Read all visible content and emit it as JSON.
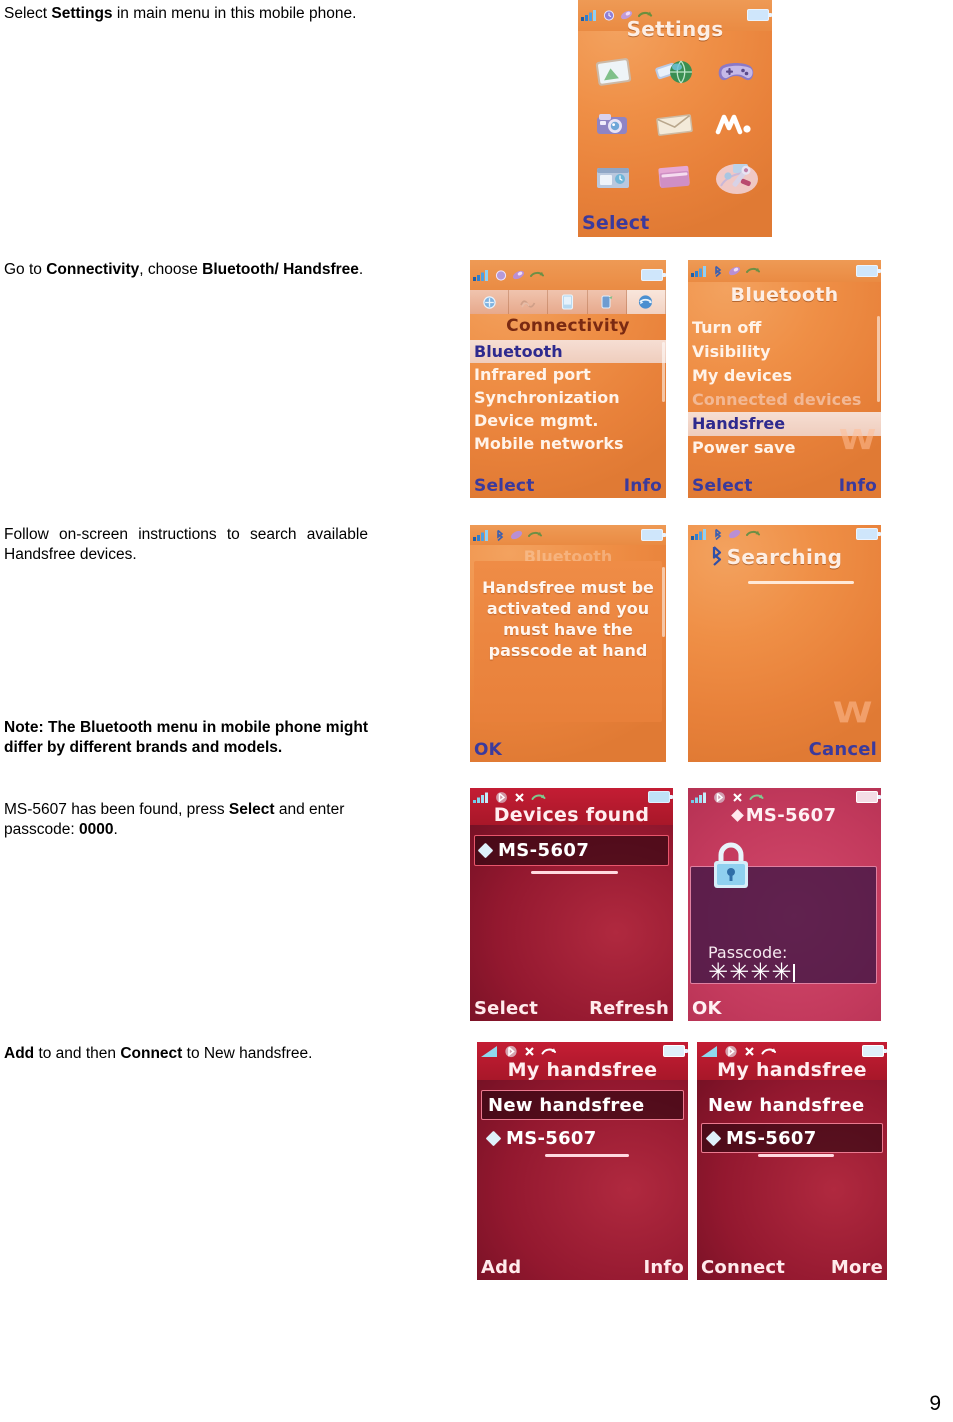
{
  "document": {
    "page_number": "9",
    "instructions": [
      {
        "id": "step-settings",
        "segments": [
          {
            "text": "Select ",
            "bold": false
          },
          {
            "text": "Settings",
            "bold": true
          },
          {
            "text": " in main menu in this mobile phone.",
            "bold": false
          }
        ]
      },
      {
        "id": "step-connectivity",
        "segments": [
          {
            "text": "Go to ",
            "bold": false
          },
          {
            "text": "Connectivity",
            "bold": true
          },
          {
            "text": ", choose ",
            "bold": false
          },
          {
            "text": "Bluetooth/ Handsfree",
            "bold": true
          },
          {
            "text": ".",
            "bold": false
          }
        ]
      },
      {
        "id": "step-search",
        "segments": [
          {
            "text": "Follow on-screen instructions to search available Handsfree devices.",
            "bold": false
          }
        ]
      },
      {
        "id": "step-note",
        "segments": [
          {
            "text": "Note: The Bluetooth menu in mobile phone might differ by different brands and models.",
            "bold": true
          }
        ]
      },
      {
        "id": "step-passcode",
        "segments": [
          {
            "text": "MS-5607 has been found, press ",
            "bold": false
          },
          {
            "text": "Select",
            "bold": true
          },
          {
            "text": " and enter passcode: ",
            "bold": false
          },
          {
            "text": "0000",
            "bold": true
          },
          {
            "text": ".",
            "bold": false
          }
        ]
      },
      {
        "id": "step-connect",
        "segments": [
          {
            "text": "Add",
            "bold": true
          },
          {
            "text": " to and then ",
            "bold": false
          },
          {
            "text": "Connect",
            "bold": true
          },
          {
            "text": " to New handsfree.",
            "bold": false
          }
        ]
      }
    ]
  },
  "screens": {
    "settings": {
      "title": "Settings",
      "softkey_left": "Select",
      "softkey_right": "",
      "icons": [
        {
          "name": "picture-gallery-icon"
        },
        {
          "name": "internet-globe-icon"
        },
        {
          "name": "games-controller-icon"
        },
        {
          "name": "camera-icon"
        },
        {
          "name": "messaging-envelope-icon"
        },
        {
          "name": "walkman-player-icon"
        },
        {
          "name": "organizer-icon"
        },
        {
          "name": "filemanager-icon"
        },
        {
          "name": "settings-tools-icon"
        }
      ],
      "status_icons": [
        "signal-bars-icon",
        "alarm-icon",
        "bluetooth-icon",
        "call-divert-icon",
        "battery-icon"
      ]
    },
    "connectivity": {
      "title": "Connectivity",
      "tabs": [
        {
          "name": "tab-general",
          "active": false
        },
        {
          "name": "tab-sounds",
          "active": false
        },
        {
          "name": "tab-display",
          "active": false
        },
        {
          "name": "tab-calls",
          "active": false
        },
        {
          "name": "tab-connectivity",
          "active": true
        }
      ],
      "items": [
        {
          "label": "Bluetooth",
          "state": "selected"
        },
        {
          "label": "Infrared port",
          "state": "normal"
        },
        {
          "label": "Synchronization",
          "state": "normal"
        },
        {
          "label": "Device mgmt.",
          "state": "normal"
        },
        {
          "label": "Mobile networks",
          "state": "normal"
        }
      ],
      "softkey_left": "Select",
      "softkey_right": "Info"
    },
    "bluetooth": {
      "title": "Bluetooth",
      "items": [
        {
          "label": "Turn off",
          "state": "normal"
        },
        {
          "label": "Visibility",
          "state": "normal"
        },
        {
          "label": "My devices",
          "state": "normal"
        },
        {
          "label": "Connected devices",
          "state": "dim"
        },
        {
          "label": "Handsfree",
          "state": "selected"
        },
        {
          "label": "Power save",
          "state": "normal"
        }
      ],
      "softkey_left": "Select",
      "softkey_right": "Info"
    },
    "handsfree_note": {
      "ghost_title": "Bluetooth",
      "message": "Handsfree must be activated and you must have the passcode at hand",
      "softkey_left": "OK",
      "softkey_right": ""
    },
    "searching": {
      "title": "Searching",
      "softkey_left": "",
      "softkey_right": "Cancel"
    },
    "devices_found": {
      "title": "Devices found",
      "device": "MS-5607",
      "softkey_left": "Select",
      "softkey_right": "Refresh"
    },
    "passcode": {
      "title": "MS-5607",
      "label": "Passcode:",
      "value": "✳✳✳✳",
      "softkey_left": "OK",
      "softkey_right": ""
    },
    "my_handsfree_add": {
      "title": "My handsfree",
      "items": [
        {
          "label": "New handsfree",
          "selected": true,
          "has_bt_icon": false
        },
        {
          "label": "MS-5607",
          "selected": false,
          "has_bt_icon": true
        }
      ],
      "softkey_left": "Add",
      "softkey_right": "Info"
    },
    "my_handsfree_connect": {
      "title": "My handsfree",
      "items": [
        {
          "label": "New handsfree",
          "selected": false,
          "has_bt_icon": false
        },
        {
          "label": "MS-5607",
          "selected": true,
          "has_bt_icon": true
        }
      ],
      "softkey_left": "Connect",
      "softkey_right": "More"
    }
  },
  "colors": {
    "orange_bg": "#e8813a",
    "orange_softkey": "#3b3a9c",
    "red_bg": "#93182f",
    "pink_bg": "#c33a5d",
    "highlight_border": "#e8566c",
    "text_white": "#ffffff"
  }
}
